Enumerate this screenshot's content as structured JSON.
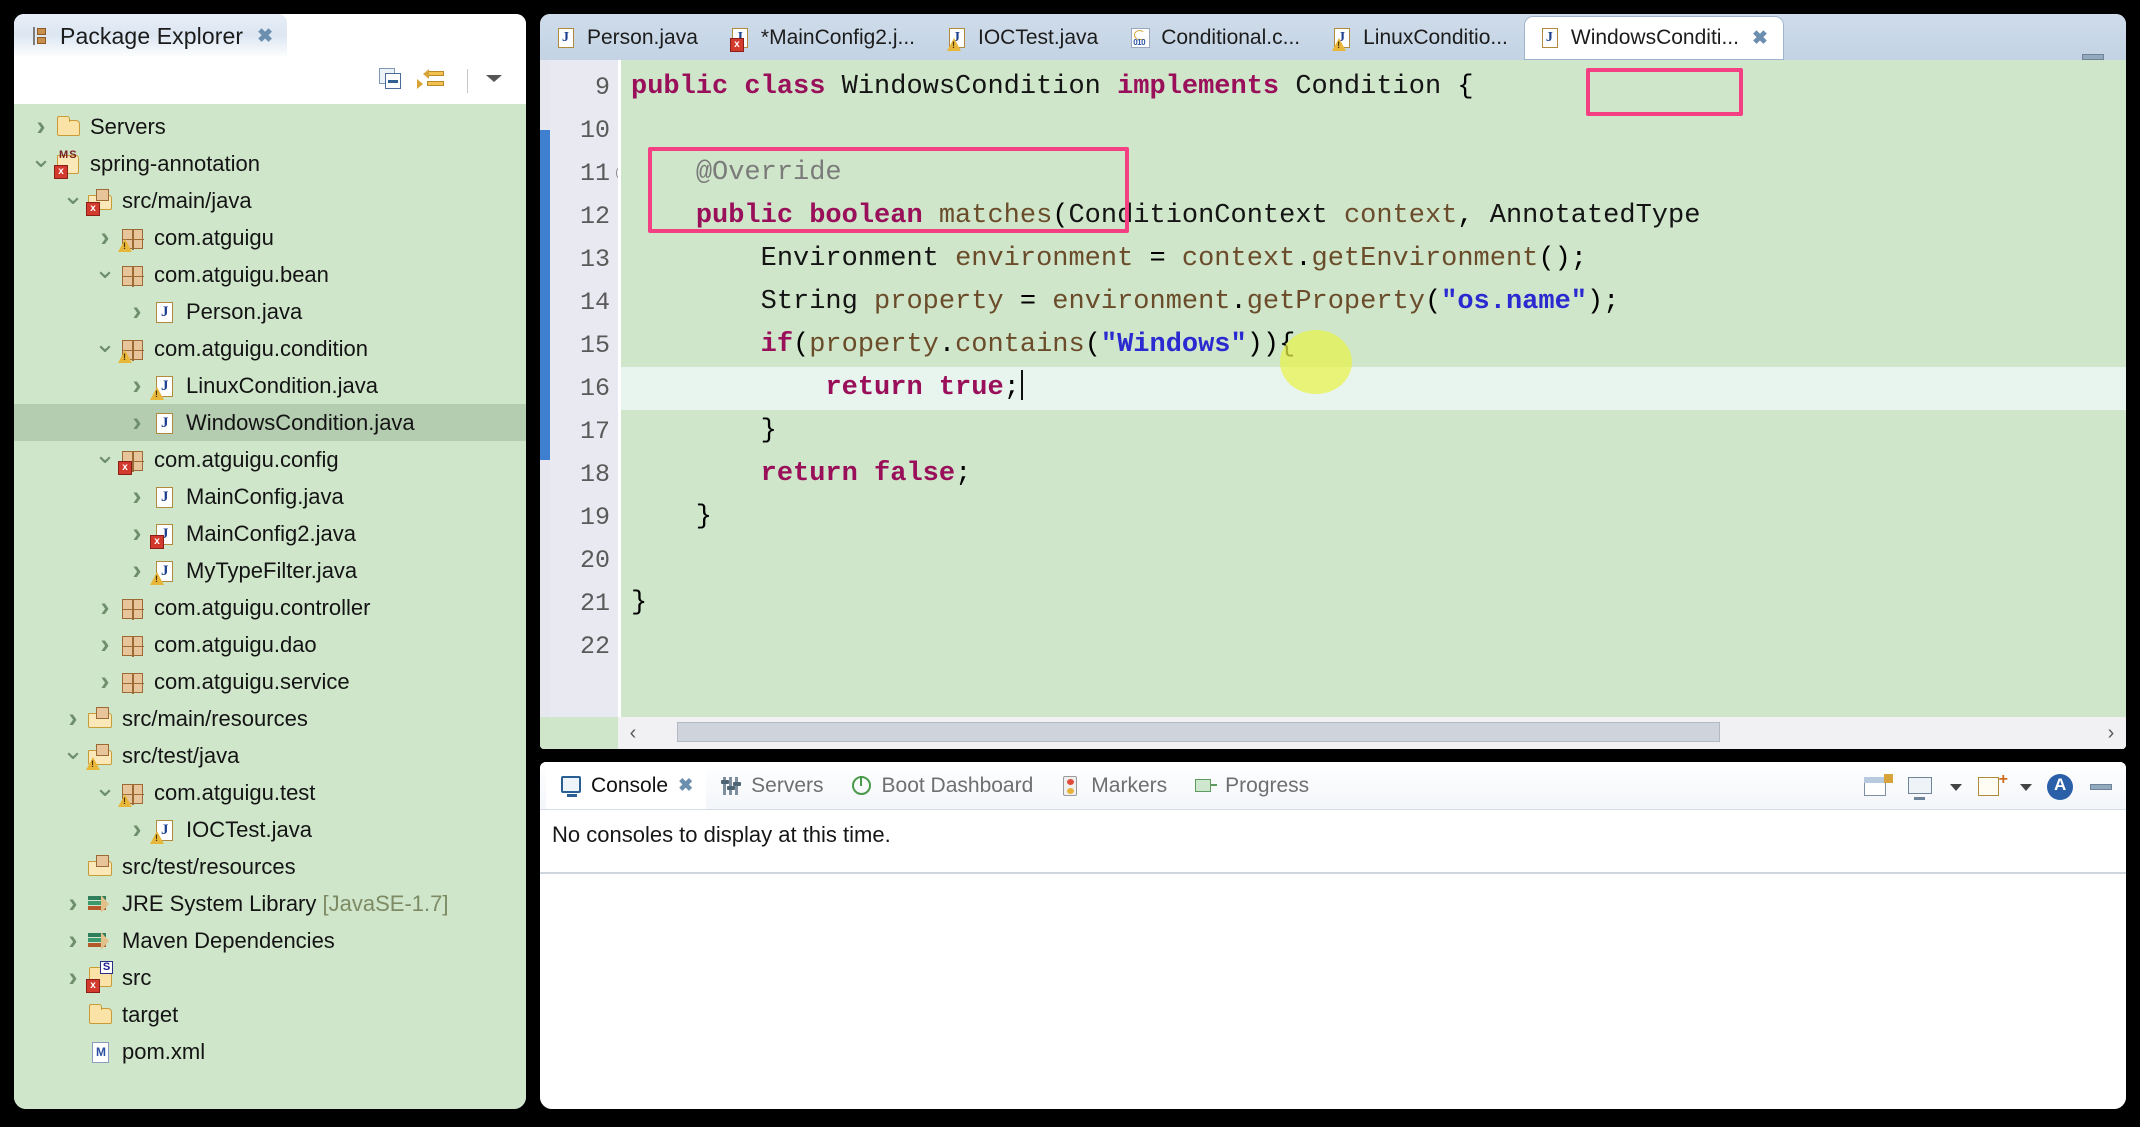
{
  "explorer": {
    "title": "Package Explorer",
    "close_label": "✖",
    "toolbar": {
      "collapse_all": "collapse-all",
      "link_with_editor": "link-with-editor",
      "view_menu": "view-menu"
    },
    "tree": [
      {
        "label": "Servers",
        "indent": 0,
        "arrow": "closed",
        "icon": "folder"
      },
      {
        "label": "spring-annotation",
        "indent": 0,
        "arrow": "open",
        "icon": "project-ms"
      },
      {
        "label": "src/main/java",
        "indent": 1,
        "arrow": "open",
        "icon": "srcfolder-error"
      },
      {
        "label": "com.atguigu",
        "indent": 2,
        "arrow": "closed",
        "icon": "package-warn"
      },
      {
        "label": "com.atguigu.bean",
        "indent": 2,
        "arrow": "open",
        "icon": "package"
      },
      {
        "label": "Person.java",
        "indent": 3,
        "arrow": "closed",
        "icon": "java"
      },
      {
        "label": "com.atguigu.condition",
        "indent": 2,
        "arrow": "open",
        "icon": "package-warn"
      },
      {
        "label": "LinuxCondition.java",
        "indent": 3,
        "arrow": "closed",
        "icon": "java-warn"
      },
      {
        "label": "WindowsCondition.java",
        "indent": 3,
        "arrow": "closed",
        "icon": "java",
        "selected": true
      },
      {
        "label": "com.atguigu.config",
        "indent": 2,
        "arrow": "open",
        "icon": "package-error"
      },
      {
        "label": "MainConfig.java",
        "indent": 3,
        "arrow": "closed",
        "icon": "java"
      },
      {
        "label": "MainConfig2.java",
        "indent": 3,
        "arrow": "closed",
        "icon": "java-error"
      },
      {
        "label": "MyTypeFilter.java",
        "indent": 3,
        "arrow": "closed",
        "icon": "java-warn"
      },
      {
        "label": "com.atguigu.controller",
        "indent": 2,
        "arrow": "closed",
        "icon": "package"
      },
      {
        "label": "com.atguigu.dao",
        "indent": 2,
        "arrow": "closed",
        "icon": "package"
      },
      {
        "label": "com.atguigu.service",
        "indent": 2,
        "arrow": "closed",
        "icon": "package"
      },
      {
        "label": "src/main/resources",
        "indent": 1,
        "arrow": "closed",
        "icon": "srcfolder"
      },
      {
        "label": "src/test/java",
        "indent": 1,
        "arrow": "open",
        "icon": "srcfolder-warn"
      },
      {
        "label": "com.atguigu.test",
        "indent": 2,
        "arrow": "open",
        "icon": "package-warn"
      },
      {
        "label": "IOCTest.java",
        "indent": 3,
        "arrow": "closed",
        "icon": "java-warn"
      },
      {
        "label": "src/test/resources",
        "indent": 1,
        "arrow": "none",
        "icon": "srcfolder"
      },
      {
        "label": "JRE System Library",
        "indent": 1,
        "arrow": "closed",
        "icon": "library",
        "suffix": "[JavaSE-1.7]"
      },
      {
        "label": "Maven Dependencies",
        "indent": 1,
        "arrow": "closed",
        "icon": "library"
      },
      {
        "label": "src",
        "indent": 1,
        "arrow": "closed",
        "icon": "project-s-error"
      },
      {
        "label": "target",
        "indent": 1,
        "arrow": "none",
        "icon": "folder"
      },
      {
        "label": "pom.xml",
        "indent": 1,
        "arrow": "none",
        "icon": "xml"
      }
    ]
  },
  "editor": {
    "tabs": [
      {
        "label": "Person.java",
        "icon": "java",
        "active": false
      },
      {
        "label": "*MainConfig2.j...",
        "icon": "java-error",
        "active": false
      },
      {
        "label": "IOCTest.java",
        "icon": "java-warn",
        "active": false
      },
      {
        "label": "Conditional.c...",
        "icon": "classfile",
        "active": false
      },
      {
        "label": "LinuxConditio...",
        "icon": "java-warn",
        "active": false
      },
      {
        "label": "WindowsConditi...",
        "icon": "java",
        "active": true,
        "close": "✖"
      }
    ],
    "minimize_label": "minimize",
    "line_numbers": [
      "9",
      "10",
      "11",
      "12",
      "13",
      "14",
      "15",
      "16",
      "17",
      "18",
      "19",
      "20",
      "21",
      "22"
    ],
    "lines": [
      "public class WindowsCondition implements Condition {",
      "",
      "    @Override",
      "    public boolean matches(ConditionContext context, AnnotatedType",
      "        Environment environment = context.getEnvironment();",
      "        String property = environment.getProperty(\"os.name\");",
      "        if(property.contains(\"Windows\")){",
      "            return true;",
      "        }",
      "        return false;",
      "    }",
      "",
      "}",
      ""
    ],
    "highlighted_line_number": "16",
    "highlights": [
      {
        "name": "condition-type-highlight",
        "target": "Condition"
      },
      {
        "name": "override-matches-highlight",
        "target": "@Override / public boolean matches"
      }
    ],
    "scrollbar": {
      "left_arrow": "‹",
      "right_arrow": "›"
    }
  },
  "console": {
    "tabs": [
      {
        "label": "Console",
        "icon": "console-icon",
        "active": true,
        "close": "✖"
      },
      {
        "label": "Servers",
        "icon": "servers-icon",
        "active": false
      },
      {
        "label": "Boot Dashboard",
        "icon": "boot-icon",
        "active": false
      },
      {
        "label": "Markers",
        "icon": "markers-icon",
        "active": false
      },
      {
        "label": "Progress",
        "icon": "progress-icon",
        "active": false
      }
    ],
    "message": "No consoles to display at this time.",
    "toolbar": [
      "pin-console-icon",
      "display-selected-console-icon",
      "display-dropdown-icon",
      "open-console-icon",
      "open-console-dropdown-icon",
      "spring-console-icon",
      "minimize-icon"
    ]
  },
  "colors": {
    "tree_background": "#cfe6cb",
    "editor_background": "#cfe6cb",
    "highlight_border": "#f43f82",
    "click_halo": "#e8f24a",
    "keyword": "#9a0f5a",
    "string": "#2a2ad0",
    "current_line": "#e8f5ee"
  }
}
